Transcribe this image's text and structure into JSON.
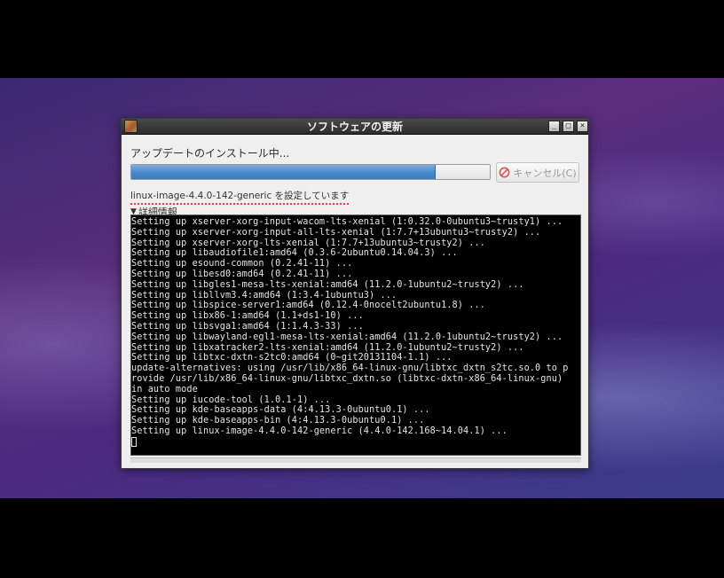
{
  "window": {
    "title": "ソフトウェアの更新",
    "min_glyph": "_",
    "max_glyph": "□",
    "close_glyph": "×"
  },
  "status_label": "アップデートのインストール中...",
  "progress": {
    "value_percent": 85
  },
  "cancel_button": {
    "label": "キャンセル(C)",
    "enabled": false
  },
  "package_status": "linux-image-4.4.0-142-generic を設定しています",
  "details_toggle": {
    "triangle": "▼",
    "label": "詳細情報"
  },
  "terminal": {
    "lines": [
      "Setting up xserver-xorg-input-wacom-lts-xenial (1:0.32.0-0ubuntu3~trusty1) ...",
      "Setting up xserver-xorg-input-all-lts-xenial (1:7.7+13ubuntu3~trusty2) ...",
      "Setting up xserver-xorg-lts-xenial (1:7.7+13ubuntu3~trusty2) ...",
      "Setting up libaudiofile1:amd64 (0.3.6-2ubuntu0.14.04.3) ...",
      "Setting up esound-common (0.2.41-11) ...",
      "Setting up libesd0:amd64 (0.2.41-11) ...",
      "Setting up libgles1-mesa-lts-xenial:amd64 (11.2.0-1ubuntu2~trusty2) ...",
      "Setting up libllvm3.4:amd64 (1:3.4-1ubuntu3) ...",
      "Setting up libspice-server1:amd64 (0.12.4-0nocelt2ubuntu1.8) ...",
      "Setting up libx86-1:amd64 (1.1+ds1-10) ...",
      "Setting up libsvga1:amd64 (1:1.4.3-33) ...",
      "Setting up libwayland-egl1-mesa-lts-xenial:amd64 (11.2.0-1ubuntu2~trusty2) ...",
      "Setting up libxatracker2-lts-xenial:amd64 (11.2.0-1ubuntu2~trusty2) ...",
      "Setting up libtxc-dxtn-s2tc0:amd64 (0~git20131104-1.1) ...",
      "update-alternatives: using /usr/lib/x86_64-linux-gnu/libtxc_dxtn_s2tc.so.0 to p",
      "rovide /usr/lib/x86_64-linux-gnu/libtxc_dxtn.so (libtxc-dxtn-x86_64-linux-gnu)",
      "in auto mode",
      "Setting up iucode-tool (1.0.1-1) ...",
      "Setting up kde-baseapps-data (4:4.13.3-0ubuntu0.1) ...",
      "Setting up kde-baseapps-bin (4:4.13.3-0ubuntu0.1) ...",
      "Setting up linux-image-4.4.0-142-generic (4.4.0-142.168~14.04.1) ..."
    ]
  },
  "colors": {
    "progress_fill": "#4a87c8",
    "terminal_bg": "#000000",
    "terminal_fg": "#e6e6e6",
    "desktop": "#4b2a80"
  }
}
